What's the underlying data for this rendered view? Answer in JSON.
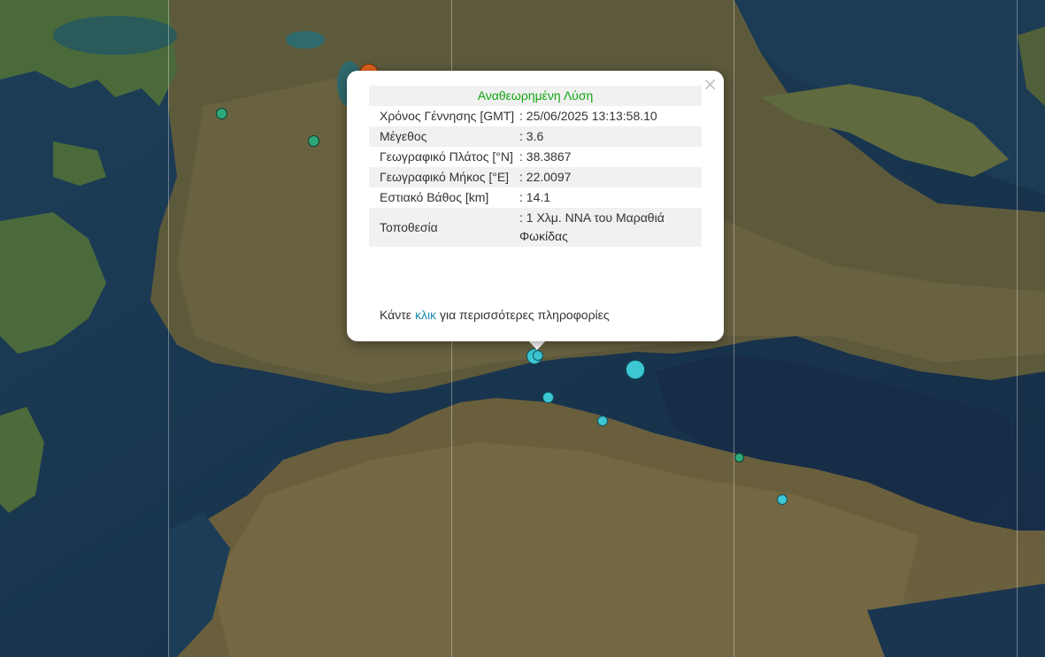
{
  "popup": {
    "title": "Αναθεωρημένη Λύση",
    "close_label": "×",
    "rows": [
      {
        "label": "Χρόνος Γέννησης [GMT]",
        "value": ": 25/06/2025 13:13:58.10"
      },
      {
        "label": "Μέγεθος",
        "value": ": 3.6"
      },
      {
        "label": "Γεωγραφικό Πλάτος [°N]",
        "value": ": 38.3867"
      },
      {
        "label": "Γεωγραφικό Μήκος [°E]",
        "value": ": 22.0097"
      },
      {
        "label": "Εστιακό Βάθος [km]",
        "value": ": 14.1"
      },
      {
        "label": "Τοποθεσία",
        "value": ": 1 Χλμ. ΝΝΑ του Μαραθιά Φωκίδας"
      }
    ],
    "footer": {
      "prefix": "Κάντε",
      "link": "κλικ",
      "suffix": "για περισσότερες πληροφορίες"
    }
  },
  "map": {
    "marker_colors": {
      "cyan": "#3cc7d3",
      "green": "#2ea87a",
      "orange": "#e0641f"
    }
  }
}
